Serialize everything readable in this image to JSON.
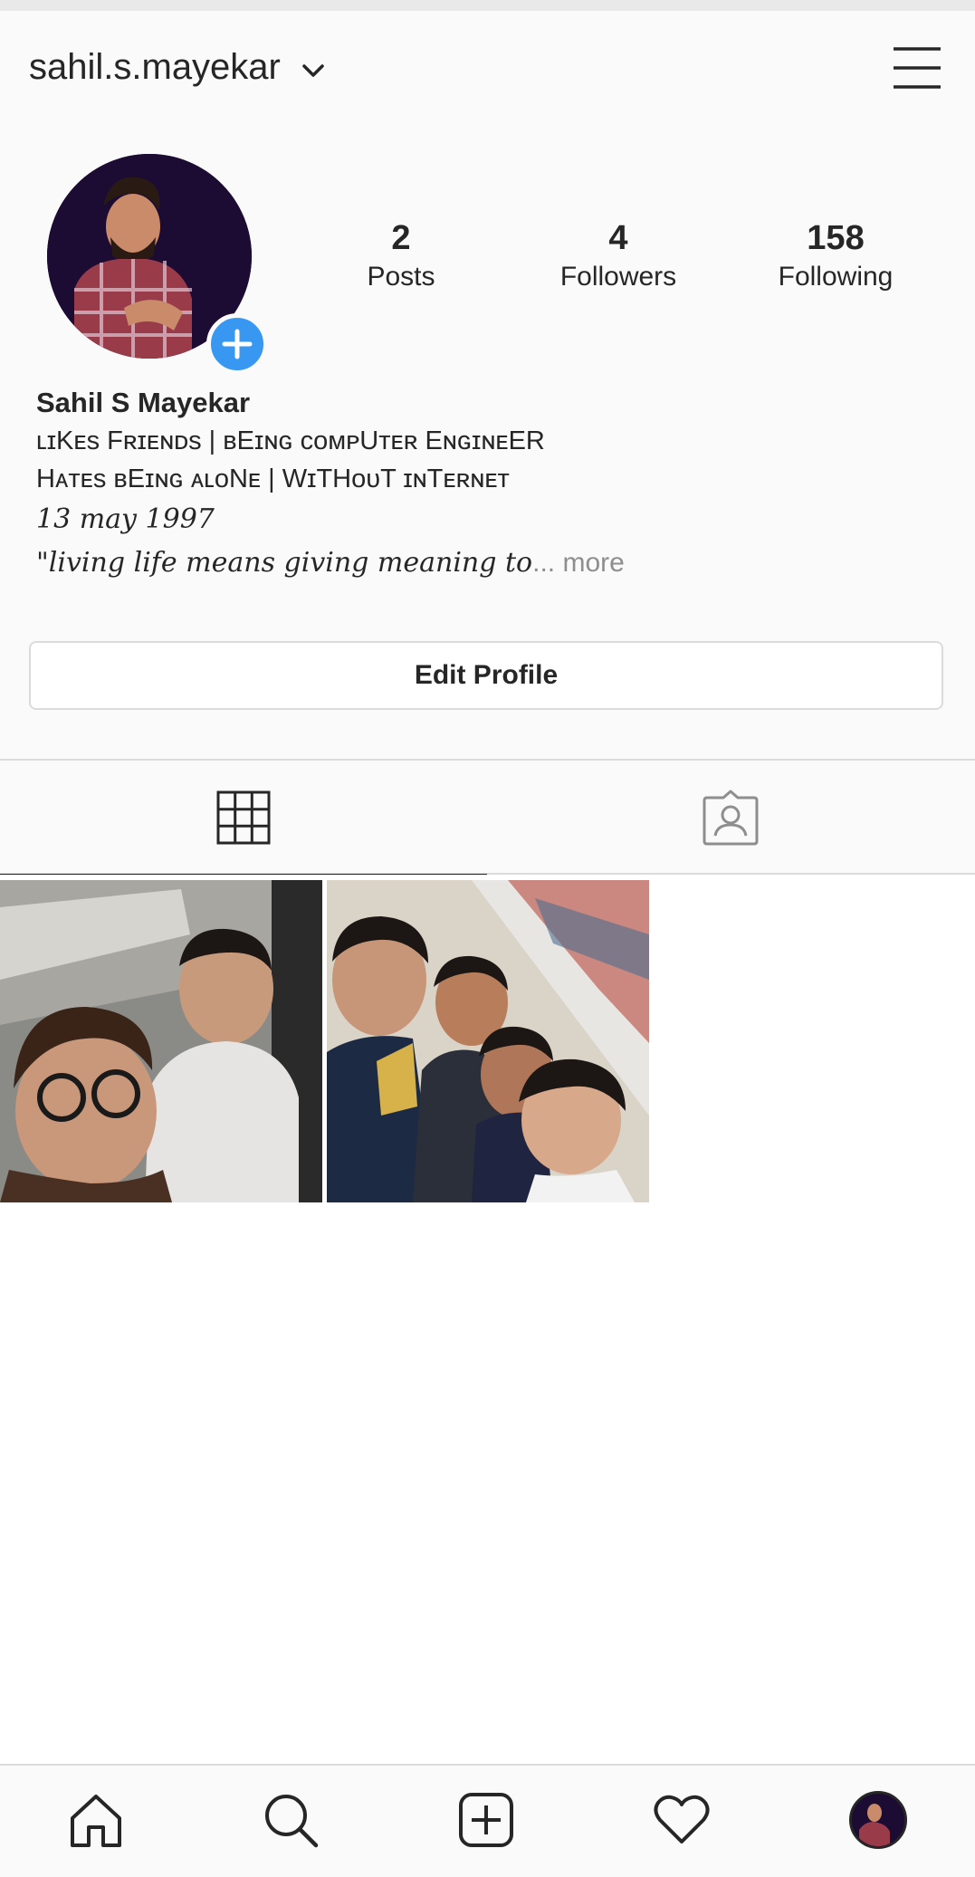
{
  "header": {
    "username": "sahil.s.mayekar",
    "dropdown_icon": "chevron-down-icon",
    "menu_icon": "hamburger-menu-icon"
  },
  "profile": {
    "stats": {
      "posts": {
        "value": "2",
        "label": "Posts"
      },
      "followers": {
        "value": "4",
        "label": "Followers"
      },
      "following": {
        "value": "158",
        "label": "Following"
      }
    },
    "name": "Sahil S Mayekar",
    "bio_lines": [
      "ʟɪKᴇs Fʀɪᴇɴᴅs | ʙEɪɴɢ ᴄᴏᴍᴘUᴛᴇʀ EɴɢɪɴᴇER",
      "Hᴀᴛᴇs ʙEɪɴɢ ᴀʟᴏNᴇ | WɪTHᴏᴜT ɪɴTᴇʀɴᴇᴛ",
      "13 may 1997",
      "\"living life means giving meaning to"
    ],
    "more_label": "... more",
    "edit_button": "Edit Profile"
  },
  "tabs": [
    {
      "name": "grid",
      "icon": "grid-icon",
      "active": true
    },
    {
      "name": "tagged",
      "icon": "tagged-person-icon",
      "active": false
    }
  ],
  "posts": [
    {
      "description": "selfie-two-friends-street"
    },
    {
      "description": "selfie-group-mall"
    }
  ],
  "bottom_nav": [
    {
      "name": "home",
      "icon": "home-icon"
    },
    {
      "name": "search",
      "icon": "search-icon"
    },
    {
      "name": "new-post",
      "icon": "add-post-icon"
    },
    {
      "name": "activity",
      "icon": "heart-icon"
    },
    {
      "name": "profile",
      "icon": "profile-avatar"
    }
  ],
  "colors": {
    "accent": "#3897f0",
    "text": "#262626",
    "muted": "#8e8e8e",
    "border": "#dbdbdb"
  }
}
